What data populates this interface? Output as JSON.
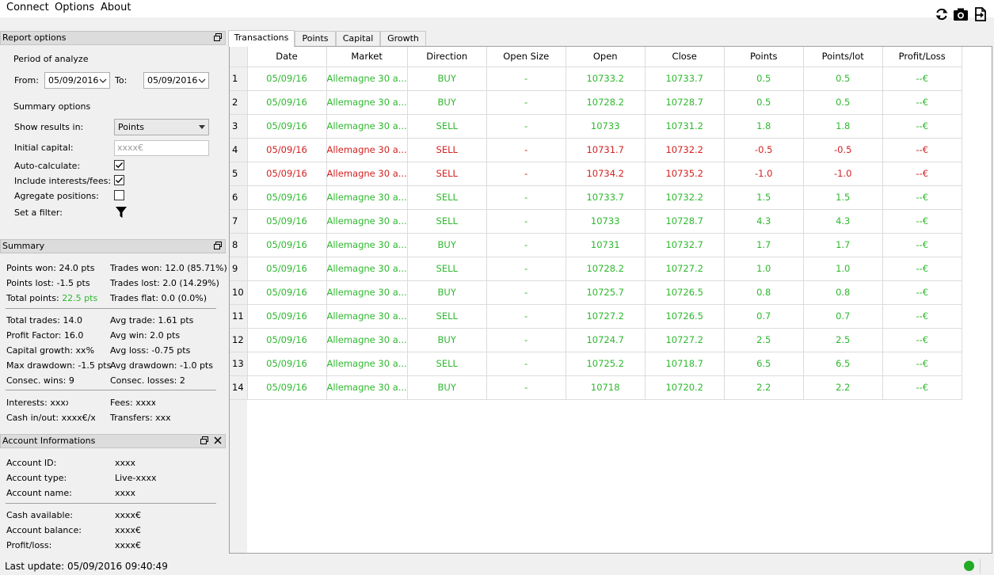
{
  "menu": [
    "Connect",
    "Options",
    "About"
  ],
  "toolbar": {
    "icons": [
      "refresh-icon",
      "camera-icon",
      "export-icon"
    ]
  },
  "report_options": {
    "title": "Report options",
    "period_label": "Period of analyze",
    "from_label": "From:",
    "from_value": "05/09/2016",
    "to_label": "To:",
    "to_value": "05/09/2016",
    "summary_options_label": "Summary options",
    "show_results_label": "Show results in:",
    "show_results_value": "Points",
    "initial_capital_label": "Initial capital:",
    "initial_capital_placeholder": "xxxx€",
    "auto_calculate_label": "Auto-calculate:",
    "auto_calculate_checked": true,
    "include_fees_label": "Include interests/fees:",
    "include_fees_checked": true,
    "aggregate_label": "Agregate positions:",
    "aggregate_checked": false,
    "filter_label": "Set a filter:"
  },
  "summary": {
    "title": "Summary",
    "points_won": "Points won: 24.0 pts",
    "trades_won": "Trades won: 12.0 (85.71%)",
    "points_lost": "Points lost: -1.5 pts",
    "trades_lost": "Trades lost: 2.0 (14.29%)",
    "total_points_label": "Total points:",
    "total_points_value": "22.5 pts",
    "trades_flat": "Trades flat: 0.0 (0.0%)",
    "total_trades": "Total trades: 14.0",
    "avg_trade": "Avg trade: 1.61 pts",
    "profit_factor": "Profit Factor: 16.0",
    "avg_win": "Avg win: 2.0 pts",
    "capital_growth": "Capital growth: xx%",
    "avg_loss": "Avg loss: -0.75 pts",
    "max_drawdown": "Max drawdown: -1.5 pts",
    "avg_drawdown": "Avg drawdown: -1.0 pts",
    "consec_wins": "Consec. wins: 9",
    "consec_losses": "Consec. losses: 2",
    "interests": "Interests: xxxx€",
    "fees": "Fees: xxxx€",
    "cash_in_out": "Cash in/out: xxxx€/xxxx€",
    "transfers": "Transfers: xxxx€"
  },
  "account": {
    "title": "Account Informations",
    "id_label": "Account ID:",
    "id_value": "xxxx",
    "type_label": "Account type:",
    "type_value": "Live-xxxx",
    "name_label": "Account name:",
    "name_value": "xxxx",
    "cash_label": "Cash available:",
    "cash_value": "xxxx€",
    "balance_label": "Account balance:",
    "balance_value": "xxxx€",
    "pl_label": "Profit/loss:",
    "pl_value": "xxxx€"
  },
  "tabs": [
    "Transactions",
    "Points",
    "Capital",
    "Growth"
  ],
  "active_tab": "Transactions",
  "table": {
    "columns": [
      "Date",
      "Market",
      "Direction",
      "Open Size",
      "Open",
      "Close",
      "Points",
      "Points/lot",
      "Profit/Loss"
    ],
    "rows": [
      {
        "n": "1",
        "date": "05/09/16",
        "market": "Allemagne 30 a...",
        "direction": "BUY",
        "open_size": "-",
        "open": "10733.2",
        "close": "10733.7",
        "points": "0.5",
        "points_lot": "0.5",
        "pl": "--€",
        "status": "win"
      },
      {
        "n": "2",
        "date": "05/09/16",
        "market": "Allemagne 30 a...",
        "direction": "BUY",
        "open_size": "-",
        "open": "10728.2",
        "close": "10728.7",
        "points": "0.5",
        "points_lot": "0.5",
        "pl": "--€",
        "status": "win"
      },
      {
        "n": "3",
        "date": "05/09/16",
        "market": "Allemagne 30 a...",
        "direction": "SELL",
        "open_size": "-",
        "open": "10733",
        "close": "10731.2",
        "points": "1.8",
        "points_lot": "1.8",
        "pl": "--€",
        "status": "win"
      },
      {
        "n": "4",
        "date": "05/09/16",
        "market": "Allemagne 30 a...",
        "direction": "SELL",
        "open_size": "-",
        "open": "10731.7",
        "close": "10732.2",
        "points": "-0.5",
        "points_lot": "-0.5",
        "pl": "--€",
        "status": "loss"
      },
      {
        "n": "5",
        "date": "05/09/16",
        "market": "Allemagne 30 a...",
        "direction": "SELL",
        "open_size": "-",
        "open": "10734.2",
        "close": "10735.2",
        "points": "-1.0",
        "points_lot": "-1.0",
        "pl": "--€",
        "status": "loss"
      },
      {
        "n": "6",
        "date": "05/09/16",
        "market": "Allemagne 30 a...",
        "direction": "SELL",
        "open_size": "-",
        "open": "10733.7",
        "close": "10732.2",
        "points": "1.5",
        "points_lot": "1.5",
        "pl": "--€",
        "status": "win"
      },
      {
        "n": "7",
        "date": "05/09/16",
        "market": "Allemagne 30 a...",
        "direction": "SELL",
        "open_size": "-",
        "open": "10733",
        "close": "10728.7",
        "points": "4.3",
        "points_lot": "4.3",
        "pl": "--€",
        "status": "win"
      },
      {
        "n": "8",
        "date": "05/09/16",
        "market": "Allemagne 30 a...",
        "direction": "BUY",
        "open_size": "-",
        "open": "10731",
        "close": "10732.7",
        "points": "1.7",
        "points_lot": "1.7",
        "pl": "--€",
        "status": "win"
      },
      {
        "n": "9",
        "date": "05/09/16",
        "market": "Allemagne 30 a...",
        "direction": "SELL",
        "open_size": "-",
        "open": "10728.2",
        "close": "10727.2",
        "points": "1.0",
        "points_lot": "1.0",
        "pl": "--€",
        "status": "win"
      },
      {
        "n": "10",
        "date": "05/09/16",
        "market": "Allemagne 30 a...",
        "direction": "BUY",
        "open_size": "-",
        "open": "10725.7",
        "close": "10726.5",
        "points": "0.8",
        "points_lot": "0.8",
        "pl": "--€",
        "status": "win"
      },
      {
        "n": "11",
        "date": "05/09/16",
        "market": "Allemagne 30 a...",
        "direction": "SELL",
        "open_size": "-",
        "open": "10727.2",
        "close": "10726.5",
        "points": "0.7",
        "points_lot": "0.7",
        "pl": "--€",
        "status": "win"
      },
      {
        "n": "12",
        "date": "05/09/16",
        "market": "Allemagne 30 a...",
        "direction": "BUY",
        "open_size": "-",
        "open": "10724.7",
        "close": "10727.2",
        "points": "2.5",
        "points_lot": "2.5",
        "pl": "--€",
        "status": "win"
      },
      {
        "n": "13",
        "date": "05/09/16",
        "market": "Allemagne 30 a...",
        "direction": "SELL",
        "open_size": "-",
        "open": "10725.2",
        "close": "10718.7",
        "points": "6.5",
        "points_lot": "6.5",
        "pl": "--€",
        "status": "win"
      },
      {
        "n": "14",
        "date": "05/09/16",
        "market": "Allemagne 30 a...",
        "direction": "BUY",
        "open_size": "-",
        "open": "10718",
        "close": "10720.2",
        "points": "2.2",
        "points_lot": "2.2",
        "pl": "--€",
        "status": "win"
      }
    ]
  },
  "status_bar": {
    "last_update": "Last update: 05/09/2016 09:40:49",
    "connection_color": "#22aa22"
  },
  "colors": {
    "win": "#2eb82e",
    "loss": "#d42020"
  }
}
